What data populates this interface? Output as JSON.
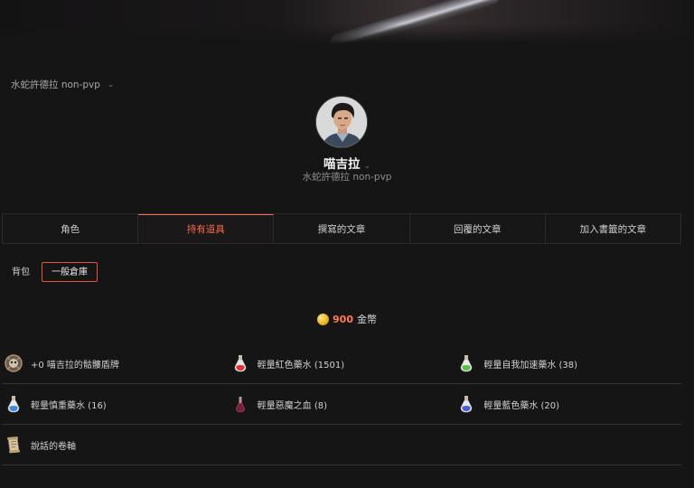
{
  "server_selector": {
    "label": "水蛇許德拉 non-pvp"
  },
  "profile": {
    "name": "喵吉拉",
    "server": "水蛇許德拉 non-pvp"
  },
  "tabs": [
    {
      "label": "角色",
      "active": false
    },
    {
      "label": "持有道具",
      "active": true
    },
    {
      "label": "撰寫的文章",
      "active": false
    },
    {
      "label": "回覆的文章",
      "active": false
    },
    {
      "label": "加入書籤的文章",
      "active": false
    }
  ],
  "subtabs": [
    {
      "label": "背包",
      "active": false
    },
    {
      "label": "一般倉庫",
      "active": true
    }
  ],
  "gold": {
    "amount": "900",
    "unit": "金幣"
  },
  "items": [
    {
      "name": "+0 喵吉拉的骷髏盾牌",
      "icon": "skull-shield-icon"
    },
    {
      "name": "輕量紅色藥水 (1501)",
      "icon": "red-potion-icon"
    },
    {
      "name": "輕量自我加速藥水 (38)",
      "icon": "green-potion-icon"
    },
    {
      "name": "輕量慎重藥水 (16)",
      "icon": "blue-potion-icon"
    },
    {
      "name": "輕量惡魔之血 (8)",
      "icon": "devil-blood-icon"
    },
    {
      "name": "輕量藍色藥水 (20)",
      "icon": "blue-potion-icon"
    },
    {
      "name": "說話的卷軸",
      "icon": "scroll-icon"
    }
  ],
  "colors": {
    "accent": "#ff6a4d",
    "background": "#161516",
    "gold_amount": "#ff7a55"
  }
}
